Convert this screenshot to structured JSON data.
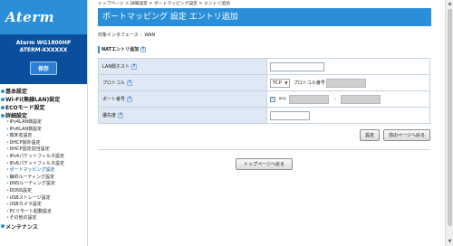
{
  "sidebar": {
    "logo": "Aterm",
    "device_model": "Aterm WG1800HP",
    "device_id": "ATERM-XXXXXX",
    "save_label": "保存",
    "sections": {
      "basic": "基本設定",
      "wifi": "Wi-Fi(無線LAN)設定",
      "eco": "ECOモード設定",
      "detail": "詳細設定",
      "maintenance": "メンテナンス"
    },
    "detail_items": [
      "IPv4LAN側設定",
      "IPv6LAN側設定",
      "端末名設定",
      "DHCP除外設定",
      "DHCP固定割当設定",
      "IPv4パケットフィルタ設定",
      "IPv6パケットフィルタ設定",
      "ポートマッピング設定",
      "静的ルーティング設定",
      "DNSルーティング設定",
      "DDNS設定",
      "USBストレージ設定",
      "USBカメラ設定",
      "PCリモート起動設定",
      "その他の設定"
    ]
  },
  "main": {
    "breadcrumb": "トップページ > 詳細設定 > ポートマッピング設定 > エントリ追加",
    "title": "ポートマッピング 設定 エントリ追加",
    "interface_line": "対象インタフェース ：WAN",
    "section_header": "NATエントリ追加",
    "help_glyph": "?",
    "fields": {
      "lan_host_label": "LAN側ホスト",
      "lan_host_value": "",
      "protocol_label": "プロトコル",
      "protocol_value": "TCP",
      "protocol_number_label": "プロトコル番号",
      "protocol_number_value": "",
      "port_label": "ポート番号",
      "port_any_label": "any",
      "port_any_checked": true,
      "port_separator": "-",
      "priority_label": "優先度",
      "priority_value": ""
    },
    "buttons": {
      "set": "設定",
      "back": "前のページへ戻る",
      "top_page": "トップページへ戻る"
    }
  },
  "colors": {
    "brand_blue": "#2a8fd8",
    "device_box_blue": "#0a4f9e",
    "label_cell_bg": "#dfe9f5",
    "disabled_input_gray": "#cfcfcf"
  },
  "icons": {
    "help": "help-icon",
    "checkbox_checked": "check-icon",
    "select_caret": "chevron-down-icon",
    "section_bullet": "circle-bullet-icon"
  }
}
